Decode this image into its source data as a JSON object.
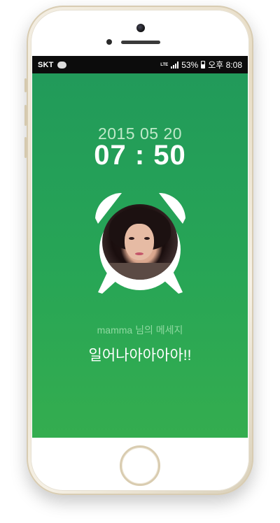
{
  "status_bar": {
    "carrier": "SKT",
    "network": "LTE",
    "battery": "53%",
    "time": "오후 8:08",
    "icons": [
      "kakaotalk-icon",
      "lte-icon",
      "signal-icon",
      "battery-icon"
    ]
  },
  "alarm": {
    "date": "2015 05 20",
    "time": "07 : 50"
  },
  "message": {
    "sender_line": "mamma 님의 메세지",
    "text": "일어나아아아아!!"
  },
  "colors": {
    "screen_green": "#27a556",
    "date_text": "#bfe9c9",
    "sender_text": "#8fd9a1"
  }
}
